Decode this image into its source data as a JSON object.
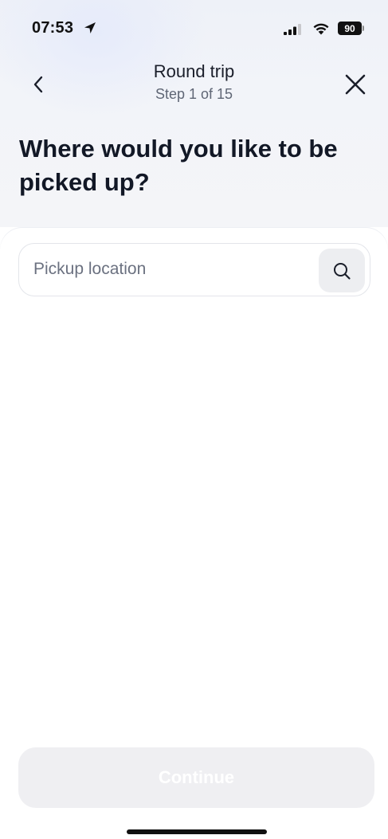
{
  "status_bar": {
    "time": "07:53",
    "battery": "90",
    "icons": [
      "location-arrow-icon",
      "signal-icon",
      "wifi-icon",
      "battery-icon"
    ]
  },
  "nav": {
    "title": "Round trip",
    "subtitle": "Step 1 of 15",
    "back_icon": "chevron-left-icon",
    "close_icon": "close-icon"
  },
  "question": "Where would you like to be picked up?",
  "search": {
    "placeholder": "Pickup location",
    "value": "",
    "button_icon": "search-icon"
  },
  "footer": {
    "continue_label": "Continue",
    "continue_state": "disabled"
  },
  "colors": {
    "header_bg": "#f2f4f9",
    "text_primary": "#121826",
    "text_secondary": "#5f6675",
    "button_disabled_bg": "#efeff2"
  }
}
